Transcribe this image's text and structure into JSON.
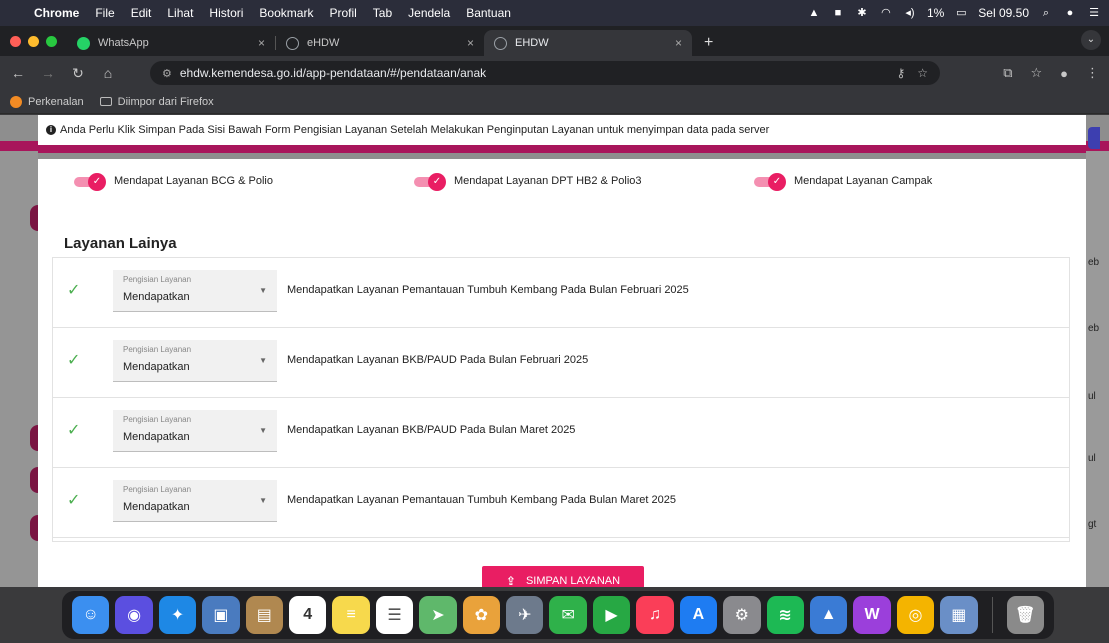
{
  "menubar": {
    "app": "Chrome",
    "items": [
      "File",
      "Edit",
      "Lihat",
      "Histori",
      "Bookmark",
      "Profil",
      "Tab",
      "Jendela",
      "Bantuan"
    ],
    "battery": "1%",
    "clock": "Sel 09.50"
  },
  "tabs": [
    {
      "title": "WhatsApp",
      "close": "×",
      "favicon_color": "#25d366"
    },
    {
      "title": "eHDW",
      "close": "×",
      "favicon_color": "#9aa0a6"
    },
    {
      "title": "EHDW",
      "close": "×",
      "favicon_color": "#9aa0a6"
    }
  ],
  "newtab_label": "+",
  "address_bar": {
    "url": "ehdw.kemendesa.go.id/app-pendataan/#/pendataan/anak"
  },
  "bookmarks": [
    {
      "label": "Perkenalan",
      "icon": "orange-globe-icon"
    },
    {
      "label": "Diimpor dari Firefox",
      "icon": "folder-icon"
    }
  ],
  "info_banner": "Anda Perlu Klik Simpan Pada Sisi Bawah Form Pengisian Layanan Setelah Melakukan Penginputan Layanan untuk menyimpan data pada server",
  "toggles": [
    {
      "label": "Mendapat Layanan BCG & Polio",
      "on": true
    },
    {
      "label": "Mendapat Layanan DPT HB2 & Polio3",
      "on": true
    },
    {
      "label": "Mendapat Layanan Campak",
      "on": true
    }
  ],
  "section_title": "Layanan Lainya",
  "services": [
    {
      "field_label": "Pengisian Layanan",
      "value": "Mendapatkan",
      "description": "Mendapatkan Layanan Pemantauan Tumbuh Kembang Pada Bulan Februari 2025"
    },
    {
      "field_label": "Pengisian Layanan",
      "value": "Mendapatkan",
      "description": "Mendapatkan Layanan BKB/PAUD Pada Bulan Februari 2025"
    },
    {
      "field_label": "Pengisian Layanan",
      "value": "Mendapatkan",
      "description": "Mendapatkan Layanan BKB/PAUD Pada Bulan Maret 2025"
    },
    {
      "field_label": "Pengisian Layanan",
      "value": "Mendapatkan",
      "description": "Mendapatkan Layanan Pemantauan Tumbuh Kembang Pada Bulan Maret 2025"
    }
  ],
  "save_button": "SIMPAN LAYANAN",
  "background_fragments": [
    "eb",
    "eb",
    "ul",
    "ul",
    "gt"
  ],
  "calendar_day": "4",
  "colors": {
    "accent": "#e91e63",
    "check": "#4caf50",
    "header_band": "#a8155b"
  },
  "dock_apps": [
    {
      "name": "finder",
      "color": "#3b8ff0",
      "glyph": "☺"
    },
    {
      "name": "siri",
      "color": "#5b4fe0",
      "glyph": "◉"
    },
    {
      "name": "safari",
      "color": "#1e88e5",
      "glyph": "✦"
    },
    {
      "name": "preview",
      "color": "#4a7bbf",
      "glyph": "▣"
    },
    {
      "name": "contacts",
      "color": "#b08850",
      "glyph": "▤"
    },
    {
      "name": "calendar",
      "color": "#ffffff",
      "glyph": ""
    },
    {
      "name": "notes",
      "color": "#f7d94c",
      "glyph": "≡"
    },
    {
      "name": "reminders",
      "color": "#ffffff",
      "glyph": "☰"
    },
    {
      "name": "maps",
      "color": "#5fb86b",
      "glyph": "➤"
    },
    {
      "name": "photos",
      "color": "#e9a23b",
      "glyph": "✿"
    },
    {
      "name": "launchpad",
      "color": "#6d7a8c",
      "glyph": "✈"
    },
    {
      "name": "messages",
      "color": "#2fb14a",
      "glyph": "✉"
    },
    {
      "name": "facetime",
      "color": "#27a844",
      "glyph": "▶"
    },
    {
      "name": "music",
      "color": "#fa3e58",
      "glyph": "♫"
    },
    {
      "name": "app-store",
      "color": "#1e7cf2",
      "glyph": "A"
    },
    {
      "name": "system-settings",
      "color": "#8a8a8e",
      "glyph": "⚙"
    },
    {
      "name": "spotify",
      "color": "#1db954",
      "glyph": "≋"
    },
    {
      "name": "preview2",
      "color": "#3a7bd5",
      "glyph": "▲"
    },
    {
      "name": "wps",
      "color": "#9b3fdb",
      "glyph": "W"
    },
    {
      "name": "chrome",
      "color": "#f4b400",
      "glyph": "◎"
    },
    {
      "name": "image-viewer",
      "color": "#6a8fc7",
      "glyph": "▦"
    },
    {
      "name": "trash",
      "color": "#8a8a8a",
      "glyph": "🗑"
    }
  ]
}
